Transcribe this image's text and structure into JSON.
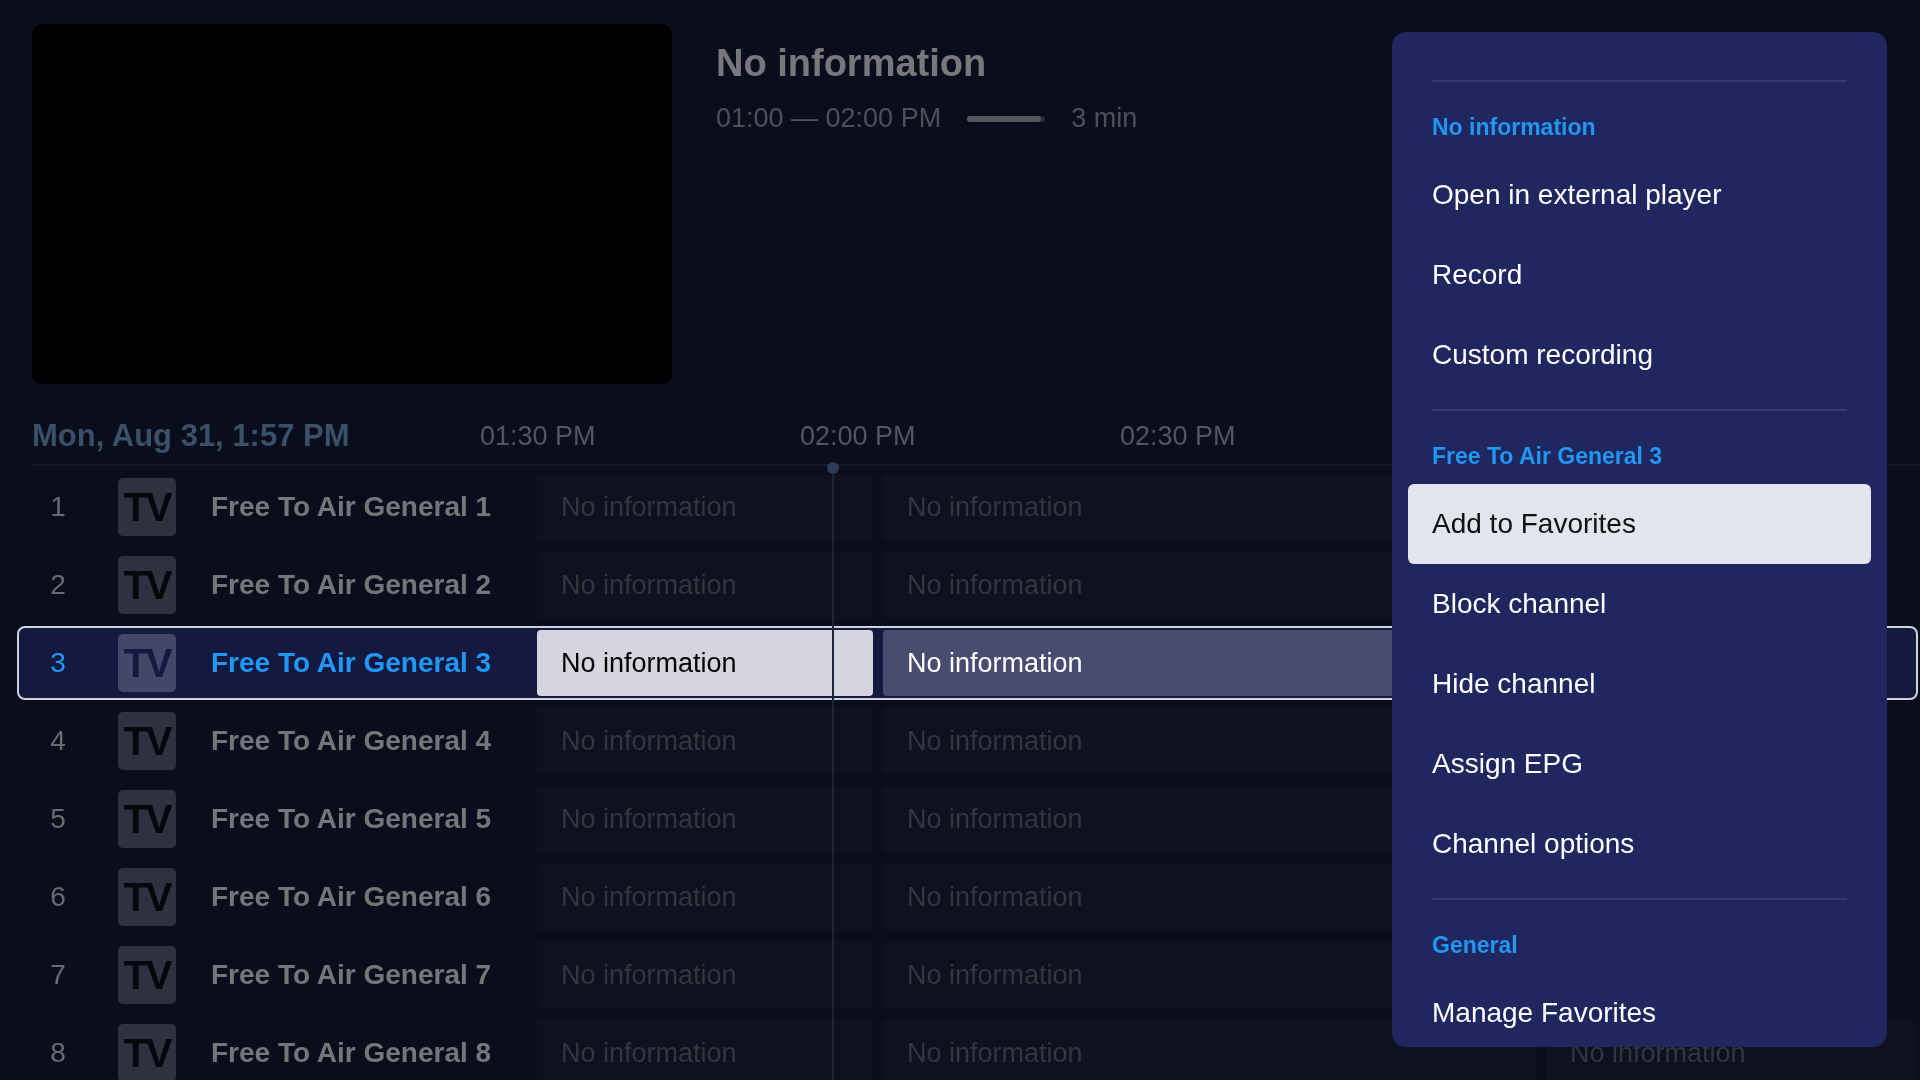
{
  "program_info": {
    "title": "No information",
    "time_range": "01:00 — 02:00 PM",
    "level": 0.95,
    "remaining": "3 min"
  },
  "guide": {
    "current_datetime": "Mon, Aug 31, 1:57 PM",
    "time_slots": [
      "01:30 PM",
      "02:00 PM",
      "02:30 PM"
    ],
    "channels": [
      {
        "number": "1",
        "logo": "TV",
        "name": "Free To Air General 1",
        "selected": false,
        "programs": [
          {
            "title": "No information",
            "focused": false
          },
          {
            "title": "No information",
            "focused": false
          }
        ]
      },
      {
        "number": "2",
        "logo": "TV",
        "name": "Free To Air General 2",
        "selected": false,
        "programs": [
          {
            "title": "No information",
            "focused": false
          },
          {
            "title": "No information",
            "focused": false
          }
        ]
      },
      {
        "number": "3",
        "logo": "TV",
        "name": "Free To Air General 3",
        "selected": true,
        "programs": [
          {
            "title": "No information",
            "focused": true
          },
          {
            "title": "No information",
            "focused": false
          }
        ]
      },
      {
        "number": "4",
        "logo": "TV",
        "name": "Free To Air General 4",
        "selected": false,
        "programs": [
          {
            "title": "No information",
            "focused": false
          },
          {
            "title": "No information",
            "focused": false
          }
        ]
      },
      {
        "number": "5",
        "logo": "TV",
        "name": "Free To Air General 5",
        "selected": false,
        "programs": [
          {
            "title": "No information",
            "focused": false
          },
          {
            "title": "No information",
            "focused": false
          }
        ]
      },
      {
        "number": "6",
        "logo": "TV",
        "name": "Free To Air General 6",
        "selected": false,
        "programs": [
          {
            "title": "No information",
            "focused": false
          },
          {
            "title": "No information",
            "focused": false
          }
        ]
      },
      {
        "number": "7",
        "logo": "TV",
        "name": "Free To Air General 7",
        "selected": false,
        "programs": [
          {
            "title": "No information",
            "focused": false
          },
          {
            "title": "No information",
            "focused": false
          }
        ]
      },
      {
        "number": "8",
        "logo": "TV",
        "name": "Free To Air General 8",
        "selected": false,
        "programs": [
          {
            "title": "No information",
            "focused": false
          },
          {
            "title": "No information",
            "focused": false
          },
          {
            "title": "No information",
            "focused": false
          }
        ]
      }
    ]
  },
  "context_menu": {
    "sections": [
      {
        "header": "No information",
        "items": [
          {
            "label": "Open in external player",
            "selected": false
          },
          {
            "label": "Record",
            "selected": false
          },
          {
            "label": "Custom recording",
            "selected": false
          }
        ]
      },
      {
        "header": "Free To Air General 3",
        "items": [
          {
            "label": "Add to Favorites",
            "selected": true
          },
          {
            "label": "Block channel",
            "selected": false
          },
          {
            "label": "Hide channel",
            "selected": false
          },
          {
            "label": "Assign EPG",
            "selected": false
          },
          {
            "label": "Channel options",
            "selected": false
          }
        ]
      },
      {
        "header": "General",
        "items": [
          {
            "label": "Manage Favorites",
            "selected": false
          }
        ]
      }
    ]
  }
}
